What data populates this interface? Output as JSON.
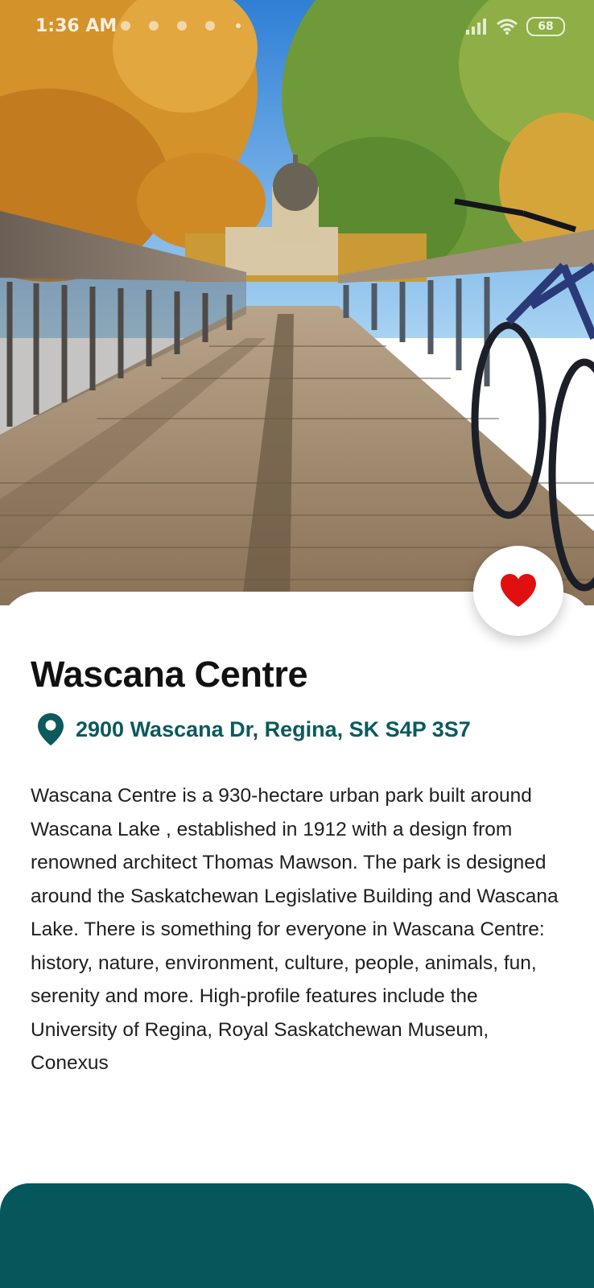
{
  "status_bar": {
    "time": "1:36 AM",
    "battery": "68",
    "icons": [
      "signal-icon",
      "wifi-icon",
      "battery-icon"
    ]
  },
  "place": {
    "name": "Wascana Centre",
    "address": "2900 Wascana Dr, Regina, SK S4P 3S7",
    "description": "Wascana Centre is a 930-hectare urban park built around Wascana Lake , established in 1912 with a design from renowned architect Thomas Mawson. The park is designed around the Saskatchewan Legislative Building and Wascana Lake. There is something for everyone in Wascana Centre: history, nature, environment, culture, people, animals, fun, serenity and more. High-profile features include the University of Regina, Royal Saskatchewan Museum, Conexus",
    "favorite": true
  },
  "colors": {
    "accent": "#0b5a5e",
    "bottom_panel": "#05575c",
    "heart": "#e01010",
    "title": "#111111",
    "body_text": "#1f1f1f"
  },
  "icons": {
    "favorite": "heart-icon",
    "location": "map-pin-icon"
  }
}
